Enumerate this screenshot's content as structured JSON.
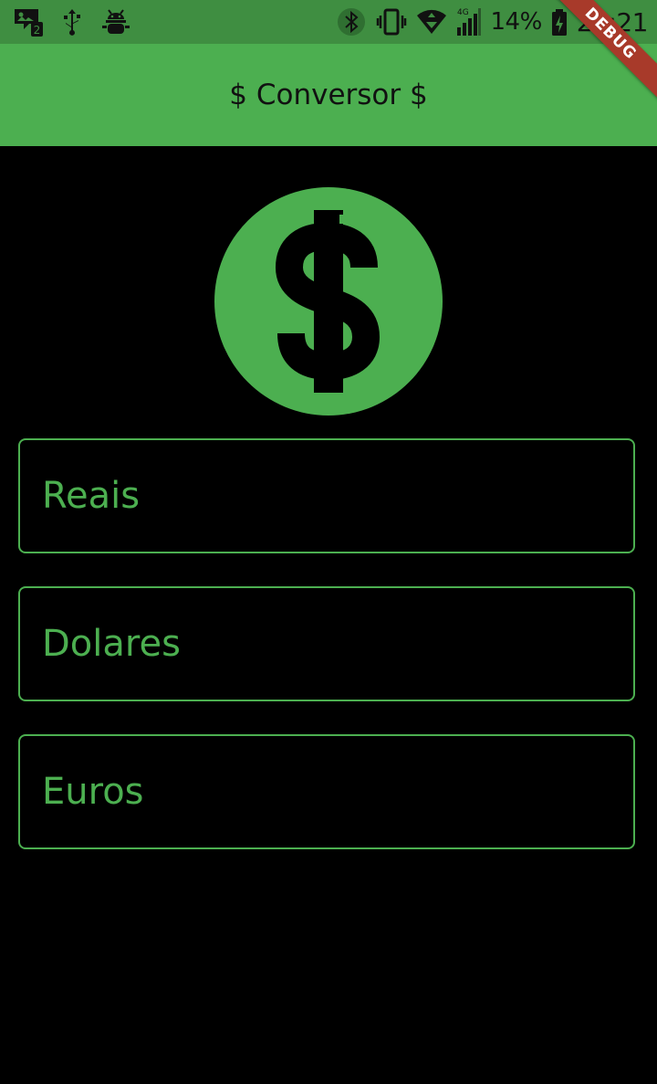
{
  "status_bar": {
    "battery": "14%",
    "clock": "22:21",
    "network": "4G",
    "notification_count": "2",
    "icons": [
      "image-notification-icon",
      "usb-icon",
      "android-debug-icon",
      "bluetooth-icon",
      "vibrate-icon",
      "wifi-icon",
      "cellular-signal-icon",
      "battery-charging-icon"
    ]
  },
  "app_bar": {
    "title": "$ Conversor $"
  },
  "debug_banner": "DEBUG",
  "main": {
    "icon": "monetization-icon",
    "fields": [
      {
        "label": "Reais",
        "value": ""
      },
      {
        "label": "Dolares",
        "value": ""
      },
      {
        "label": "Euros",
        "value": ""
      }
    ]
  },
  "colors": {
    "primary": "#4caf50",
    "status_bar": "#3f8e41",
    "background": "#000000",
    "debug": "#a83a2a"
  }
}
